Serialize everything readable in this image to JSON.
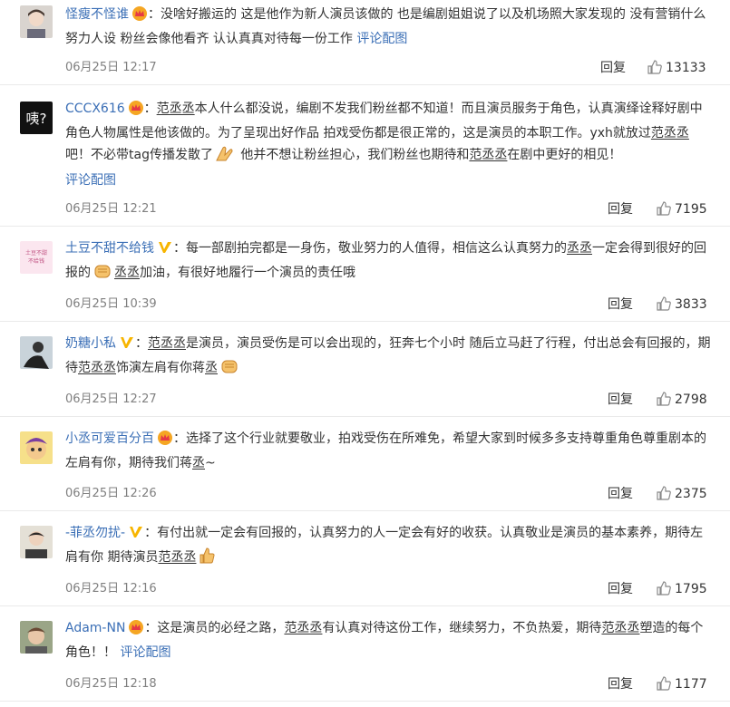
{
  "actions": {
    "reply_label": "回复",
    "pic_label": "评论配图"
  },
  "colors": {
    "link": "#3b6fb6",
    "crown": "#f5a623",
    "vip_v": "#f7b500"
  },
  "comments": [
    {
      "user": "怪瘦不怪谁",
      "badge": "crown-icon",
      "parts": [
        "：没啥好搬运的 这是他作为新人演员该做的 也是编剧姐姐说了以及机场照大家发现的 没有营销什么努力人设 粉丝会像他看齐 认认真真对待每一份工作 "
      ],
      "time": "06月25日 12:17",
      "likes": "13133"
    },
    {
      "user": "CCCX616",
      "badge": "crown-icon",
      "parts": [
        "：",
        "范丞丞",
        "本人什么都没说，编剧不发我们粉丝都不知道！而且演员服务于角色，认真演绎诠释好剧中角色人物属性是他该做的。为了呈现出好作品 拍戏受伤都是很正常的，这是演员的本职工作。yxh就放过",
        "范丞丞",
        "吧！不必带tag传播发散了",
        " 他并不想让粉丝担心，我们粉丝也期待和",
        "范丞丞",
        "在剧中更好的相见！"
      ],
      "time": "06月25日 12:21",
      "likes": "7195"
    },
    {
      "user": "土豆不甜不给钱",
      "badge": "vip-v-icon",
      "parts": [
        "：每一部剧拍完都是一身伤，敬业努力的人值得，相信这么认真努力的",
        "丞丞",
        "一定会得到很好的回报的",
        "丞丞",
        "加油，有很好地履行一个演员的责任哦"
      ],
      "time": "06月25日 10:39",
      "likes": "3833"
    },
    {
      "user": "奶糖小私",
      "badge": "vip-v-icon",
      "parts": [
        "：",
        "范丞丞",
        "是演员，演员受伤是可以会出现的，狂奔七个小时 随后立马赶了行程，付出总会有回报的，期待",
        "范丞丞",
        "饰演左肩有你蒋",
        "丞"
      ],
      "time": "06月25日 12:27",
      "likes": "2798"
    },
    {
      "user": "小丞可爱百分百",
      "badge": "crown-icon",
      "parts": [
        "：选择了这个行业就要敬业，拍戏受伤在所难免，希望大家到时候多多支持尊重角色尊重剧本的左肩有你，期待我们蒋",
        "丞",
        "~"
      ],
      "time": "06月25日 12:26",
      "likes": "2375"
    },
    {
      "user": "-菲丞勿扰-",
      "badge": "vip-v-icon",
      "parts": [
        "：有付出就一定会有回报的，认真努力的人一定会有好的收获。认真敬业是演员的基本素养，期待左肩有你 期待演员",
        "范丞丞"
      ],
      "time": "06月25日 12:16",
      "likes": "1795"
    },
    {
      "user": "Adam-NN",
      "badge": "crown-icon",
      "parts": [
        "：这是演员的必经之路，",
        "范丞丞",
        "有认真对待这份工作，继续努力，不负热爱，期待",
        "范丞丞",
        "塑造的每个角色！！ "
      ],
      "time": "06月25日 12:18",
      "likes": "1177"
    }
  ]
}
